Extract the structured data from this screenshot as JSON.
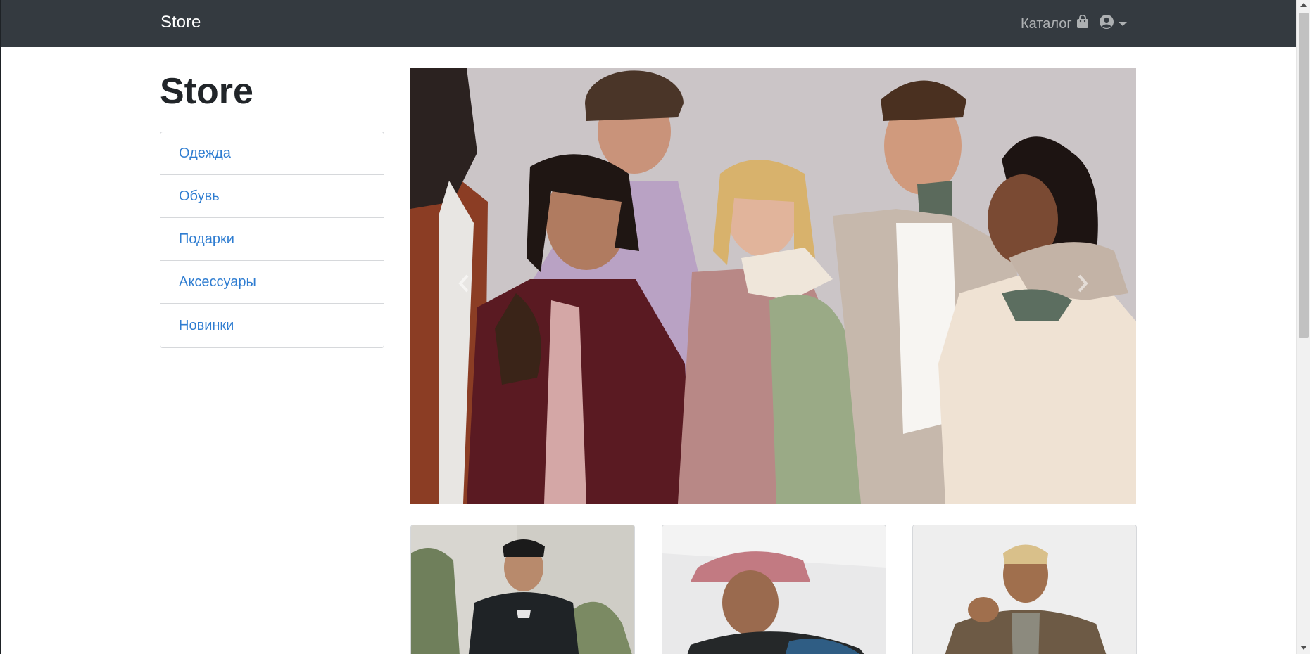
{
  "navbar": {
    "brand": "Store",
    "catalog_label": "Каталог",
    "catalog_icon": "shopping-bag-icon",
    "user_icon": "user-circle-icon",
    "background": "#343a40"
  },
  "page": {
    "title": "Store"
  },
  "sidebar": {
    "items": [
      {
        "label": "Одежда"
      },
      {
        "label": "Обувь"
      },
      {
        "label": "Подарки"
      },
      {
        "label": "Аксессуары"
      },
      {
        "label": "Новинки"
      }
    ],
    "link_color": "#2f7dd1"
  },
  "carousel": {
    "slide_count": 3,
    "active_index": 1,
    "prev_icon": "chevron-left-icon",
    "next_icon": "chevron-right-icon"
  },
  "products": {
    "count": 3
  }
}
